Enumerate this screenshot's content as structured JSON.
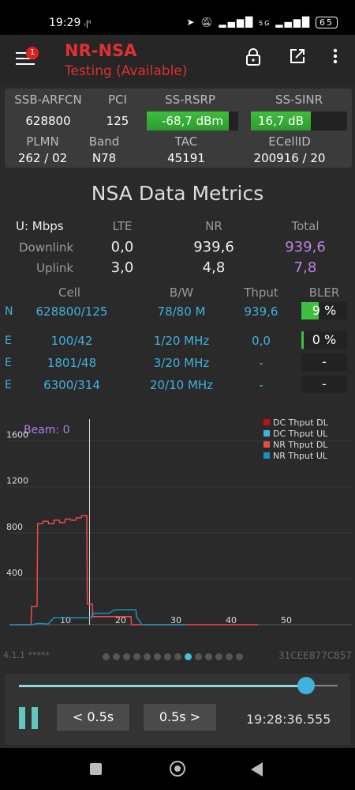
{
  "status_bar": {
    "time": "19:29",
    "net_indicator": "5G",
    "battery": "65",
    "icons": [
      "signal-icon",
      "location-icon",
      "mute-icon",
      "wifi-signal-icon",
      "battery-icon"
    ]
  },
  "app_bar": {
    "title": "NR-NSA",
    "subtitle": "Testing (Available)",
    "notification_count": "1",
    "icons": [
      "menu-icon",
      "lock-icon",
      "open-external-icon",
      "more-vert-icon"
    ]
  },
  "info_card": {
    "headers1": [
      "SSB-ARFCN",
      "PCI",
      "SS-RSRP",
      "SS-SINR"
    ],
    "ssb_arfcn": "628800",
    "pci": "125",
    "ss_rsrp": "-68,7 dBm",
    "ss_rsrp_level": 0.9,
    "ss_sinr": "16,7 dB",
    "ss_sinr_level": 0.62,
    "headers2": [
      "PLMN",
      "Band",
      "TAC",
      "ECellID"
    ],
    "plmn": "262 / 02",
    "band": "N78",
    "tac": "45191",
    "ecellid": "200916 / 20",
    "meter_color": "#3cbf3c"
  },
  "metrics": {
    "title": "NSA Data Metrics",
    "unit_label": "U: Mbps",
    "col_headers": [
      "LTE",
      "NR",
      "Total"
    ],
    "downlink_label": "Downlink",
    "uplink_label": "Uplink",
    "downlink": {
      "lte": "0,0",
      "nr": "939,6",
      "total": "939,6"
    },
    "uplink": {
      "lte": "3,0",
      "nr": "4,8",
      "total": "7,8"
    }
  },
  "cells": {
    "headers": [
      "Cell",
      "B/W",
      "Thput",
      "BLER"
    ],
    "rows": [
      {
        "type": "N",
        "cell": "628800/125",
        "bw": "78/80 M",
        "thput": "939,6",
        "bler": "9 %",
        "bler_level": 0.38
      },
      {
        "type": "E",
        "cell": "100/42",
        "bw": "1/20 MHz",
        "thput": "0,0",
        "bler": "0 %",
        "bler_level": 0.06
      },
      {
        "type": "E",
        "cell": "1801/48",
        "bw": "3/20 MHz",
        "thput": "-",
        "bler": "-",
        "bler_level": 0
      },
      {
        "type": "E",
        "cell": "6300/314",
        "bw": "20/10 MHz",
        "thput": "-",
        "bler": "-",
        "bler_level": 0
      }
    ]
  },
  "chart_data": {
    "type": "line",
    "beam_label": "Beam: 0",
    "xticks": [
      10,
      20,
      30,
      40,
      50
    ],
    "yticks": [
      400,
      800,
      1200,
      1600
    ],
    "xlim": [
      0,
      62
    ],
    "ylim": [
      0,
      1790
    ],
    "cursor_x": 14.5,
    "legend": [
      "DC Thput DL",
      "DC Thput UL",
      "NR Thput DL",
      "NR Thput UL"
    ],
    "series": [
      {
        "name": "DC Thput DL",
        "color": "#c01010",
        "x": [],
        "y": []
      },
      {
        "name": "DC Thput UL",
        "color": "#3fb2e0",
        "x": [],
        "y": []
      },
      {
        "name": "NR Thput DL",
        "color": "#f04848",
        "x": [
          0,
          3.9,
          4,
          5,
          5.1,
          6,
          6.1,
          7,
          7.1,
          8,
          8.1,
          9,
          9.1,
          10,
          10.1,
          11,
          11.1,
          12,
          12.1,
          13,
          13.1,
          14,
          14.1,
          15,
          15.1,
          16,
          16.1,
          18,
          18.1,
          19,
          19.1,
          22,
          22.1,
          25,
          26,
          35,
          40,
          45
        ],
        "y": [
          0,
          0,
          160,
          160,
          880,
          880,
          900,
          900,
          880,
          880,
          910,
          910,
          890,
          890,
          920,
          920,
          910,
          910,
          930,
          930,
          950,
          950,
          180,
          180,
          70,
          70,
          70,
          70,
          70,
          70,
          70,
          70,
          0,
          0,
          0,
          0,
          0,
          0
        ]
      },
      {
        "name": "NR Thput UL",
        "color": "#1a90c0",
        "x": [
          0,
          4,
          5,
          6,
          7,
          8,
          9,
          10,
          11,
          12,
          13,
          14,
          14.9,
          15,
          17,
          18,
          19,
          20,
          21,
          22,
          22.9,
          23,
          24,
          25,
          28,
          31,
          32
        ],
        "y": [
          0,
          0,
          10,
          10,
          5,
          60,
          60,
          60,
          60,
          60,
          60,
          60,
          60,
          100,
          100,
          100,
          130,
          130,
          130,
          130,
          130,
          70,
          0,
          0,
          0,
          0,
          0
        ]
      }
    ]
  },
  "footer": {
    "version": "4.1.1 *****",
    "device_id": "31CEE877C857",
    "page_count": 14,
    "active_page": 8
  },
  "player": {
    "position": 0.9,
    "back_label": "< 0.5s",
    "forward_label": "0.5s >",
    "timestamp": "19:28:36.555"
  },
  "nav": [
    "recents-icon",
    "home-icon",
    "back-icon"
  ]
}
